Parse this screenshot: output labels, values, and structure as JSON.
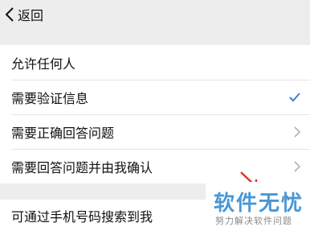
{
  "nav": {
    "back_label": "返回",
    "back_icon": "chevron-left-icon"
  },
  "options": [
    {
      "label": "允许任何人",
      "selected": false,
      "accessory": "none"
    },
    {
      "label": "需要验证信息",
      "selected": true,
      "accessory": "checkmark-icon"
    },
    {
      "label": "需要正确回答问题",
      "selected": false,
      "accessory": "chevron-right-icon"
    },
    {
      "label": "需要回答问题并由我确认",
      "selected": false,
      "accessory": "chevron-right-icon"
    }
  ],
  "phone_search": {
    "label": "可通过手机号码搜索到我"
  },
  "watermark": {
    "title": "软件无忧",
    "subtitle": "努力解决软件问题"
  },
  "colors": {
    "background": "#ededed",
    "cell": "#ffffff",
    "accent": "#3b82d6",
    "chevron": "#b2b2b2",
    "watermark_title": "#4a97d6",
    "pointer_arrow": "#e0302a"
  }
}
